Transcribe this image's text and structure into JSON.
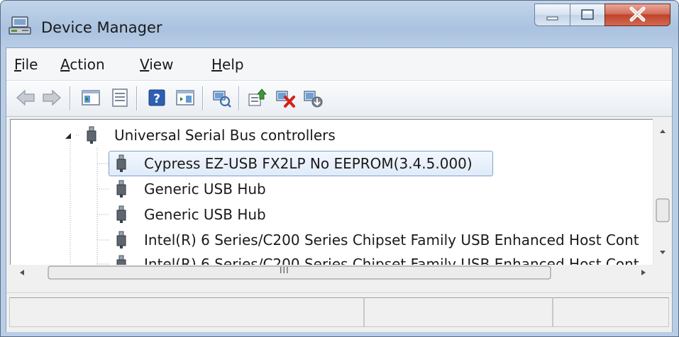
{
  "window": {
    "title": "Device Manager",
    "app_icon": "device-manager-icon",
    "controls": [
      "minimize-icon",
      "maximize-icon",
      "close-icon"
    ]
  },
  "menu": [
    {
      "label": "File",
      "mnemonic": "F"
    },
    {
      "label": "Action",
      "mnemonic": "A"
    },
    {
      "label": "View",
      "mnemonic": "V"
    },
    {
      "label": "Help",
      "mnemonic": "H"
    }
  ],
  "toolbar": {
    "icons": [
      "back-arrow-icon",
      "forward-arrow-icon",
      "show-hide-console-tree-icon",
      "properties-icon",
      "help-icon",
      "show-hide-action-pane-icon",
      "scan-hardware-changes-icon",
      "update-driver-icon",
      "uninstall-device-icon",
      "disable-device-icon"
    ]
  },
  "tree": {
    "category": {
      "label": "Universal Serial Bus controllers",
      "expanded": true
    },
    "devices": [
      {
        "label": "Cypress EZ-USB FX2LP No EEPROM(3.4.5.000)",
        "selected": true
      },
      {
        "label": "Generic USB Hub"
      },
      {
        "label": "Generic USB Hub"
      },
      {
        "label": "Intel(R) 6 Series/C200 Series Chipset Family USB Enhanced Host Cont"
      },
      {
        "label": "Intel(R) 6 Series/C200 Series Chipset Family USB Enhanced Host Cont"
      }
    ]
  },
  "scrollbar": {
    "grip": "III"
  },
  "colors": {
    "selection_border": "#7da2ce",
    "selection_fill": "#e0ebf8",
    "close_button": "#c1432b",
    "title_bar": "#aac3e0"
  }
}
